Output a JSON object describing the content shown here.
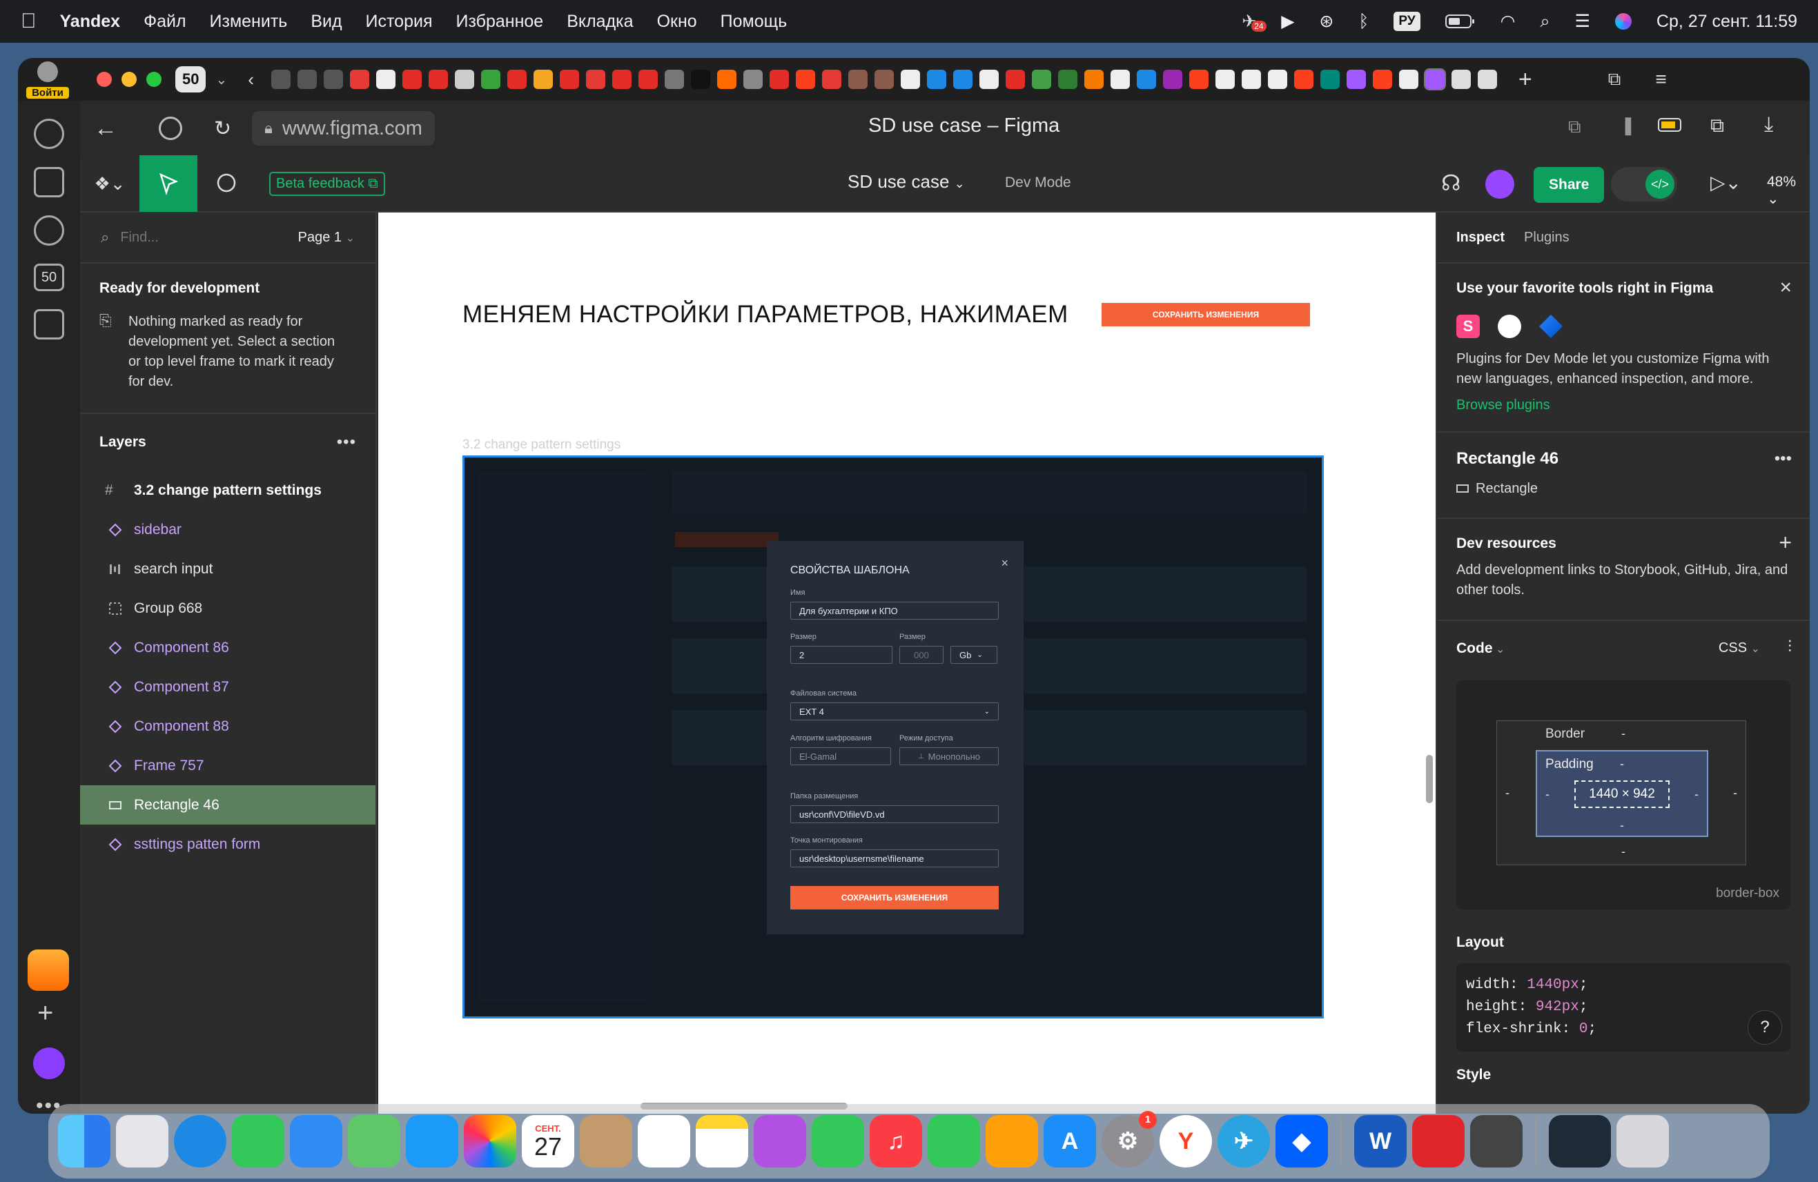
{
  "menubar": {
    "app": "Yandex",
    "items": [
      "Файл",
      "Изменить",
      "Вид",
      "История",
      "Избранное",
      "Вкладка",
      "Окно",
      "Помощь"
    ],
    "keyboard": "РУ",
    "datetime": "Ср, 27 сент.  11:59"
  },
  "browser": {
    "login_label": "Войти",
    "tab_count": "50",
    "sidebar_count": "50",
    "url": "www.figma.com",
    "page_title": "SD use case – Figma",
    "badge_count": "24"
  },
  "figma": {
    "file_name": "SD use case",
    "dev_mode": "Dev Mode",
    "beta_feedback": "Beta feedback",
    "share": "Share",
    "zoom": "48%"
  },
  "left_panel": {
    "find_placeholder": "Find...",
    "page": "Page 1",
    "ready_title": "Ready for development",
    "ready_text": "Nothing marked as ready for development yet. Select a section or top level frame to mark it ready for dev.",
    "layers_title": "Layers",
    "frame_name": "3.2 change pattern settings",
    "layers": [
      {
        "name": "sidebar",
        "kind": "component"
      },
      {
        "name": "search input",
        "kind": "group"
      },
      {
        "name": "Group 668",
        "kind": "group"
      },
      {
        "name": "Component 86",
        "kind": "component"
      },
      {
        "name": "Component 87",
        "kind": "component"
      },
      {
        "name": "Component 88",
        "kind": "component"
      },
      {
        "name": "Frame 757",
        "kind": "component"
      },
      {
        "name": "Rectangle 46",
        "kind": "rect",
        "selected": true
      },
      {
        "name": "ssttings patten form",
        "kind": "component"
      }
    ]
  },
  "canvas": {
    "heading": "МЕНЯЕМ НАСТРОЙКИ ПАРАМЕТРОВ, НАЖИМАЕМ",
    "heading_button": "СОХРАНИТЬ ИЗМЕНЕНИЯ",
    "frame_label": "3.2 change pattern settings",
    "modal": {
      "title": "СВОЙСТВА ШАБЛОНА",
      "name_label": "Имя",
      "name_value": "Для бухгалтерии и КПО",
      "size_label": "Размер",
      "size_value": "2",
      "size2_label": "Размер",
      "size2_placeholder": "000",
      "unit": "Gb",
      "fs_label": "Файловая система",
      "fs_value": "EXT 4",
      "algo_label": "Алгоритм шифрования",
      "algo_value": "El-Gamal",
      "access_label": "Режим доступа",
      "access_value": "Монопольно",
      "folder_label": "Папка размещения",
      "folder_value": "usr\\conf\\VD\\fileVD.vd",
      "mount_label": "Точка монтирования",
      "mount_value": "usr\\desktop\\usernsme\\filename",
      "save": "СОХРАНИТЬ ИЗМЕНЕНИЯ"
    }
  },
  "right_panel": {
    "tab_inspect": "Inspect",
    "tab_plugins": "Plugins",
    "promo_title": "Use your favorite tools right in Figma",
    "promo_text": "Plugins for Dev Mode let you customize Figma with new languages, enhanced inspection, and more.",
    "browse": "Browse plugins",
    "selection_name": "Rectangle 46",
    "selection_type": "Rectangle",
    "dev_resources_title": "Dev resources",
    "dev_resources_text": "Add development links to Storybook, GitHub, Jira, and other tools.",
    "code_title": "Code",
    "code_lang": "CSS",
    "box_border": "Border",
    "box_padding": "Padding",
    "box_size": "1440 × 942",
    "dash": "-",
    "box_sizing": "border-box",
    "layout_title": "Layout",
    "css": [
      {
        "prop": "width",
        "value": "1440px"
      },
      {
        "prop": "height",
        "value": "942px"
      },
      {
        "prop": "flex-shrink",
        "value": "0"
      }
    ],
    "help": "?",
    "style_title": "Style"
  },
  "dock": {
    "calendar_month": "СЕНТ.",
    "calendar_day": "27",
    "settings_badge": "1"
  },
  "colors": {
    "figma_green": "#0d9f5d",
    "selection_blue": "#1e88e5",
    "orange_button": "#f4623a",
    "component_purple": "#c8a4ff"
  }
}
